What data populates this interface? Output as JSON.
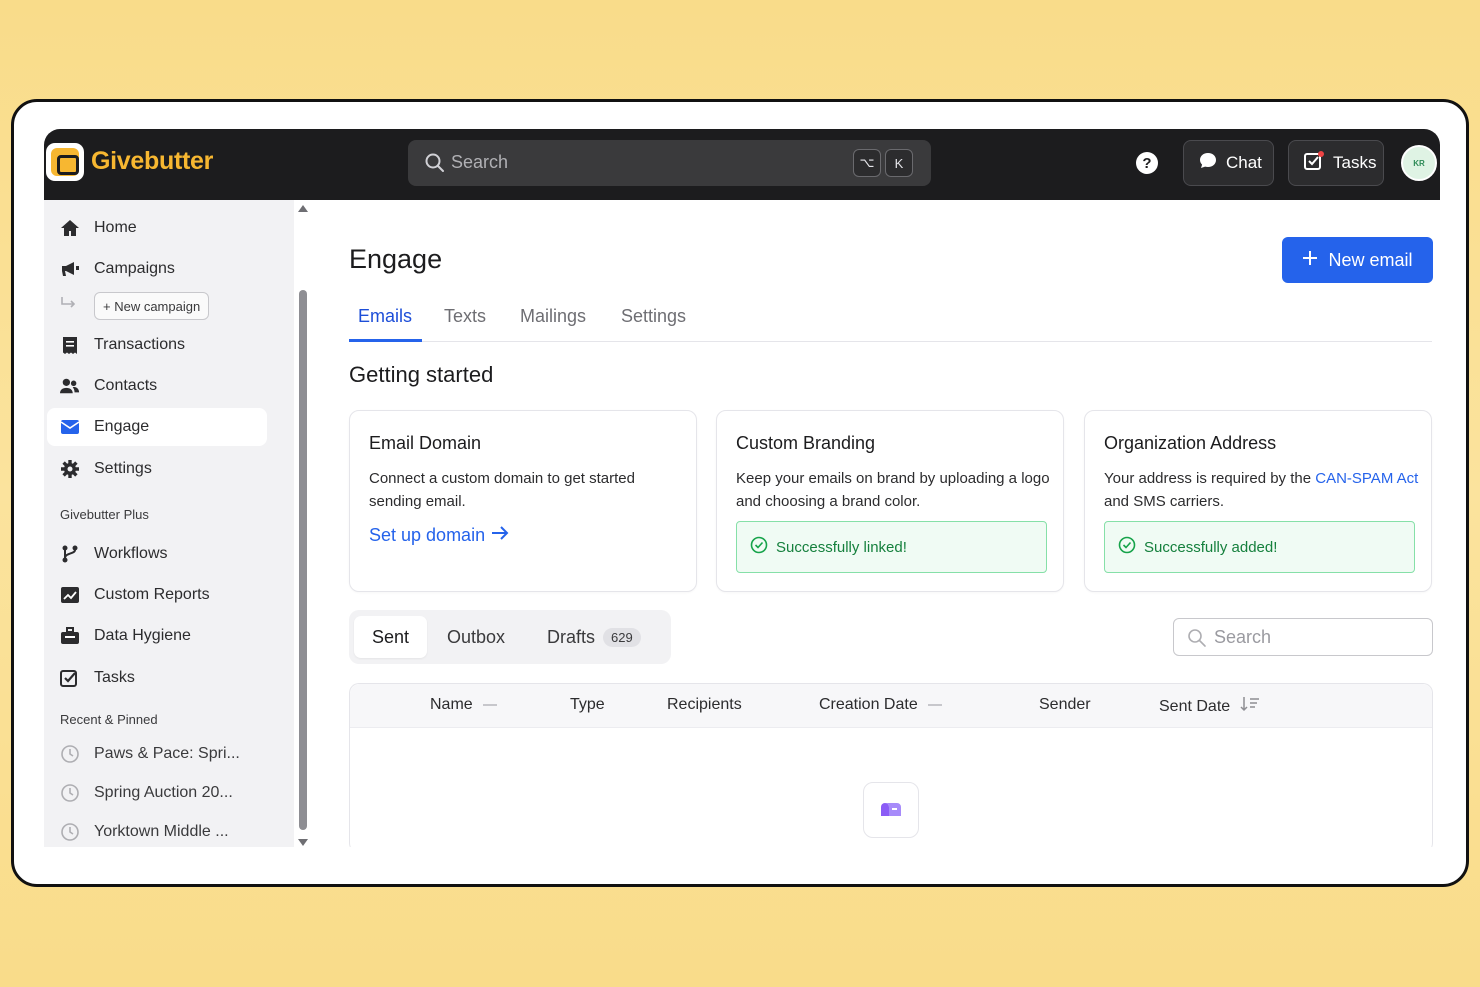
{
  "brand": {
    "name": "Givebutter",
    "accent": "#f7b731",
    "primary": "#2563eb"
  },
  "topbar": {
    "search_placeholder": "Search",
    "shortcut_keys": [
      "⌥",
      "K"
    ],
    "help_label": "?",
    "chat_label": "Chat",
    "tasks_label": "Tasks",
    "avatar_initials": "KR"
  },
  "sidebar": {
    "items": [
      {
        "label": "Home",
        "icon": "home-icon"
      },
      {
        "label": "Campaigns",
        "icon": "megaphone-icon"
      },
      {
        "label": "Transactions",
        "icon": "receipt-icon"
      },
      {
        "label": "Contacts",
        "icon": "users-icon"
      },
      {
        "label": "Engage",
        "icon": "mail-icon",
        "active": true
      },
      {
        "label": "Settings",
        "icon": "gear-icon"
      }
    ],
    "new_campaign_label": "+ New campaign",
    "plus_section": "Givebutter Plus",
    "plus_items": [
      {
        "label": "Workflows",
        "icon": "workflow-icon"
      },
      {
        "label": "Custom Reports",
        "icon": "chart-icon"
      },
      {
        "label": "Data Hygiene",
        "icon": "toolbox-icon"
      },
      {
        "label": "Tasks",
        "icon": "task-icon"
      }
    ],
    "recent_section": "Recent & Pinned",
    "recent_items": [
      {
        "label": "Paws & Pace: Spri...",
        "icon": "clock-icon"
      },
      {
        "label": "Spring Auction 20...",
        "icon": "clock-icon"
      },
      {
        "label": "Yorktown Middle ...",
        "icon": "clock-icon"
      }
    ]
  },
  "main": {
    "title": "Engage",
    "new_email_label": "New email",
    "tabs": [
      {
        "label": "Emails",
        "active": true
      },
      {
        "label": "Texts"
      },
      {
        "label": "Mailings"
      },
      {
        "label": "Settings"
      }
    ],
    "section_title": "Getting started",
    "cards": {
      "domain": {
        "title": "Email Domain",
        "desc": "Connect a custom domain to get started sending email.",
        "link": "Set up domain"
      },
      "branding": {
        "title": "Custom Branding",
        "desc": "Keep your emails on brand by uploading a logo and choosing a brand color.",
        "status": "Successfully linked!"
      },
      "address": {
        "title": "Organization Address",
        "desc_before": "Your address is required by the ",
        "desc_link": "CAN-SPAM Act",
        "desc_after": " and SMS carriers.",
        "status": "Successfully added!"
      }
    },
    "list_tabs": {
      "sent": "Sent",
      "outbox": "Outbox",
      "drafts": "Drafts",
      "drafts_count": "629"
    },
    "list_search_placeholder": "Search",
    "table_headers": [
      "Name",
      "Type",
      "Recipients",
      "Creation Date",
      "Sender",
      "Sent Date"
    ]
  }
}
